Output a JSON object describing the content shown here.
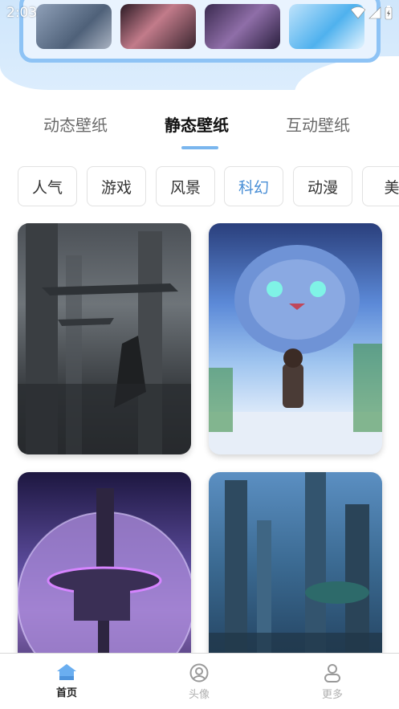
{
  "status_bar": {
    "time": "2:03",
    "icons": [
      "wifi-icon",
      "signal-icon",
      "battery-icon"
    ]
  },
  "banner": {
    "thumbnails": [
      "banner-image-1",
      "banner-image-2",
      "banner-image-3",
      "banner-image-4"
    ]
  },
  "tabs": [
    {
      "label": "动态壁纸"
    },
    {
      "label": "静态壁纸"
    },
    {
      "label": "互动壁纸"
    }
  ],
  "active_tab": "静态壁纸",
  "categories": [
    {
      "label": "人气"
    },
    {
      "label": "游戏"
    },
    {
      "label": "风景"
    },
    {
      "label": "科幻"
    },
    {
      "label": "动漫"
    },
    {
      "label": "美"
    }
  ],
  "active_category": "科幻",
  "wallpapers": [
    {
      "name": "sci-fi city with spaceships"
    },
    {
      "name": "blue furry monster and child"
    },
    {
      "name": "space station over purple planet"
    },
    {
      "name": "futuristic city towers"
    }
  ],
  "bottom_nav": [
    {
      "label": "首页",
      "icon": "home-icon"
    },
    {
      "label": "头像",
      "icon": "avatar-icon"
    },
    {
      "label": "更多",
      "icon": "person-icon"
    }
  ],
  "colors": {
    "accent": "#7ab6ee",
    "active_chip_text": "#4a8fd6",
    "header_bg": "#cfe6fb",
    "home_icon": "#6aaef0"
  }
}
